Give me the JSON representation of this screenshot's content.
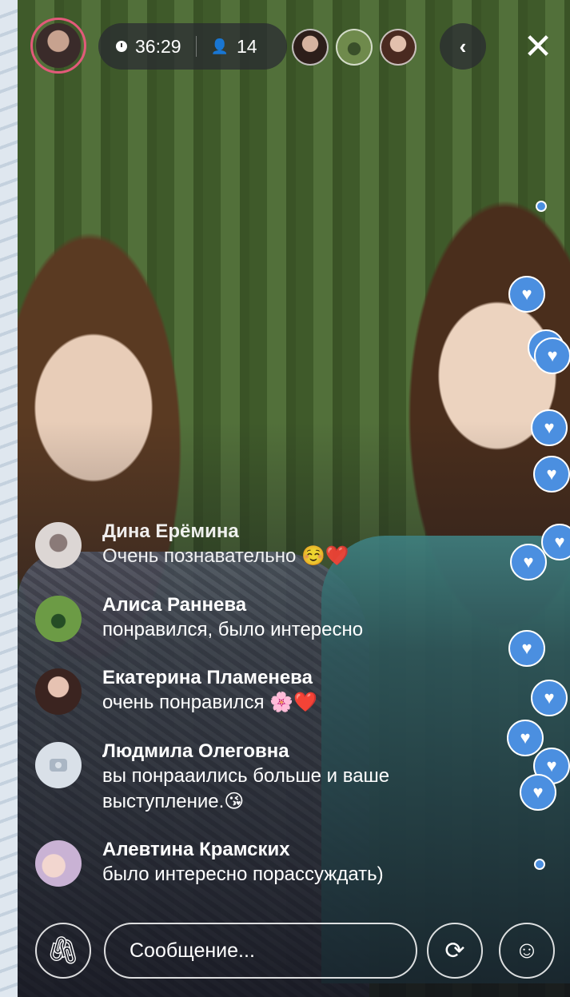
{
  "header": {
    "duration": "36:29",
    "viewer_count": "14",
    "back_icon": "‹",
    "close_icon": "✕"
  },
  "comments": [
    {
      "name": "Дина Ерёмина",
      "text": "Очень познавательно ☺️❤️"
    },
    {
      "name": "Алиса Раннева",
      "text": "понравился, было интересно"
    },
    {
      "name": "Екатерина Пламенева",
      "text": "очень понравился 🌸❤️"
    },
    {
      "name": "Людмила Олеговна",
      "text": "вы понрааились больше и ваше выступление.😘"
    },
    {
      "name": "Алевтина Крамских",
      "text": "было интересно порассуждать)"
    }
  ],
  "composer": {
    "placeholder": "Сообщение..."
  },
  "colors": {
    "accent": "#4b8fe0",
    "host_ring": "#e25a7a",
    "pill_bg": "#2828328c"
  },
  "icons": {
    "attach": "paperclip-icon",
    "flip": "camera-flip-icon",
    "mask": "mask-icon",
    "heart": "heart-icon",
    "clock": "clock-icon",
    "viewers": "person-icon"
  }
}
